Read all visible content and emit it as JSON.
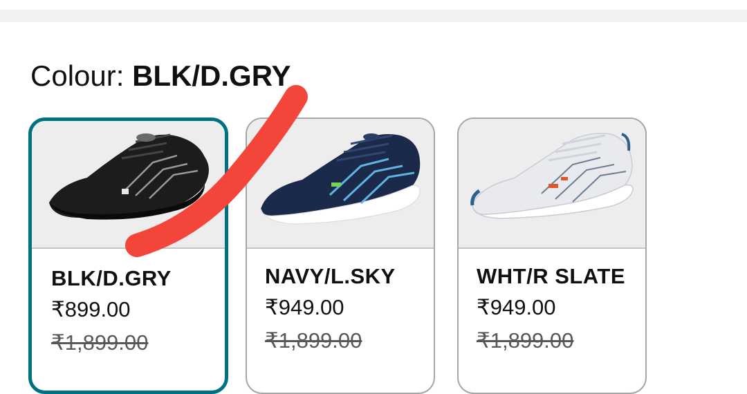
{
  "colour_selector": {
    "label": "Colour: ",
    "selected_value": "BLK/D.GRY"
  },
  "swatches": [
    {
      "name": "BLK/D.GRY",
      "price": "₹899.00",
      "mrp": "₹1,899.00",
      "selected": true,
      "shoe_color": "#1c1c1e",
      "accent_color": "#9a9a9a"
    },
    {
      "name": "NAVY/L.SKY",
      "price": "₹949.00",
      "mrp": "₹1,899.00",
      "selected": false,
      "shoe_color": "#1b2a4a",
      "accent_color": "#5fb4e0"
    },
    {
      "name": "WHT/R SLATE",
      "price": "₹949.00",
      "mrp": "₹1,899.00",
      "selected": false,
      "shoe_color": "#e8eaee",
      "accent_color": "#2f5f8f"
    }
  ],
  "colors": {
    "selected_border": "#007185",
    "default_border": "#a6a6a6",
    "annotation_stroke": "#f4453a"
  }
}
